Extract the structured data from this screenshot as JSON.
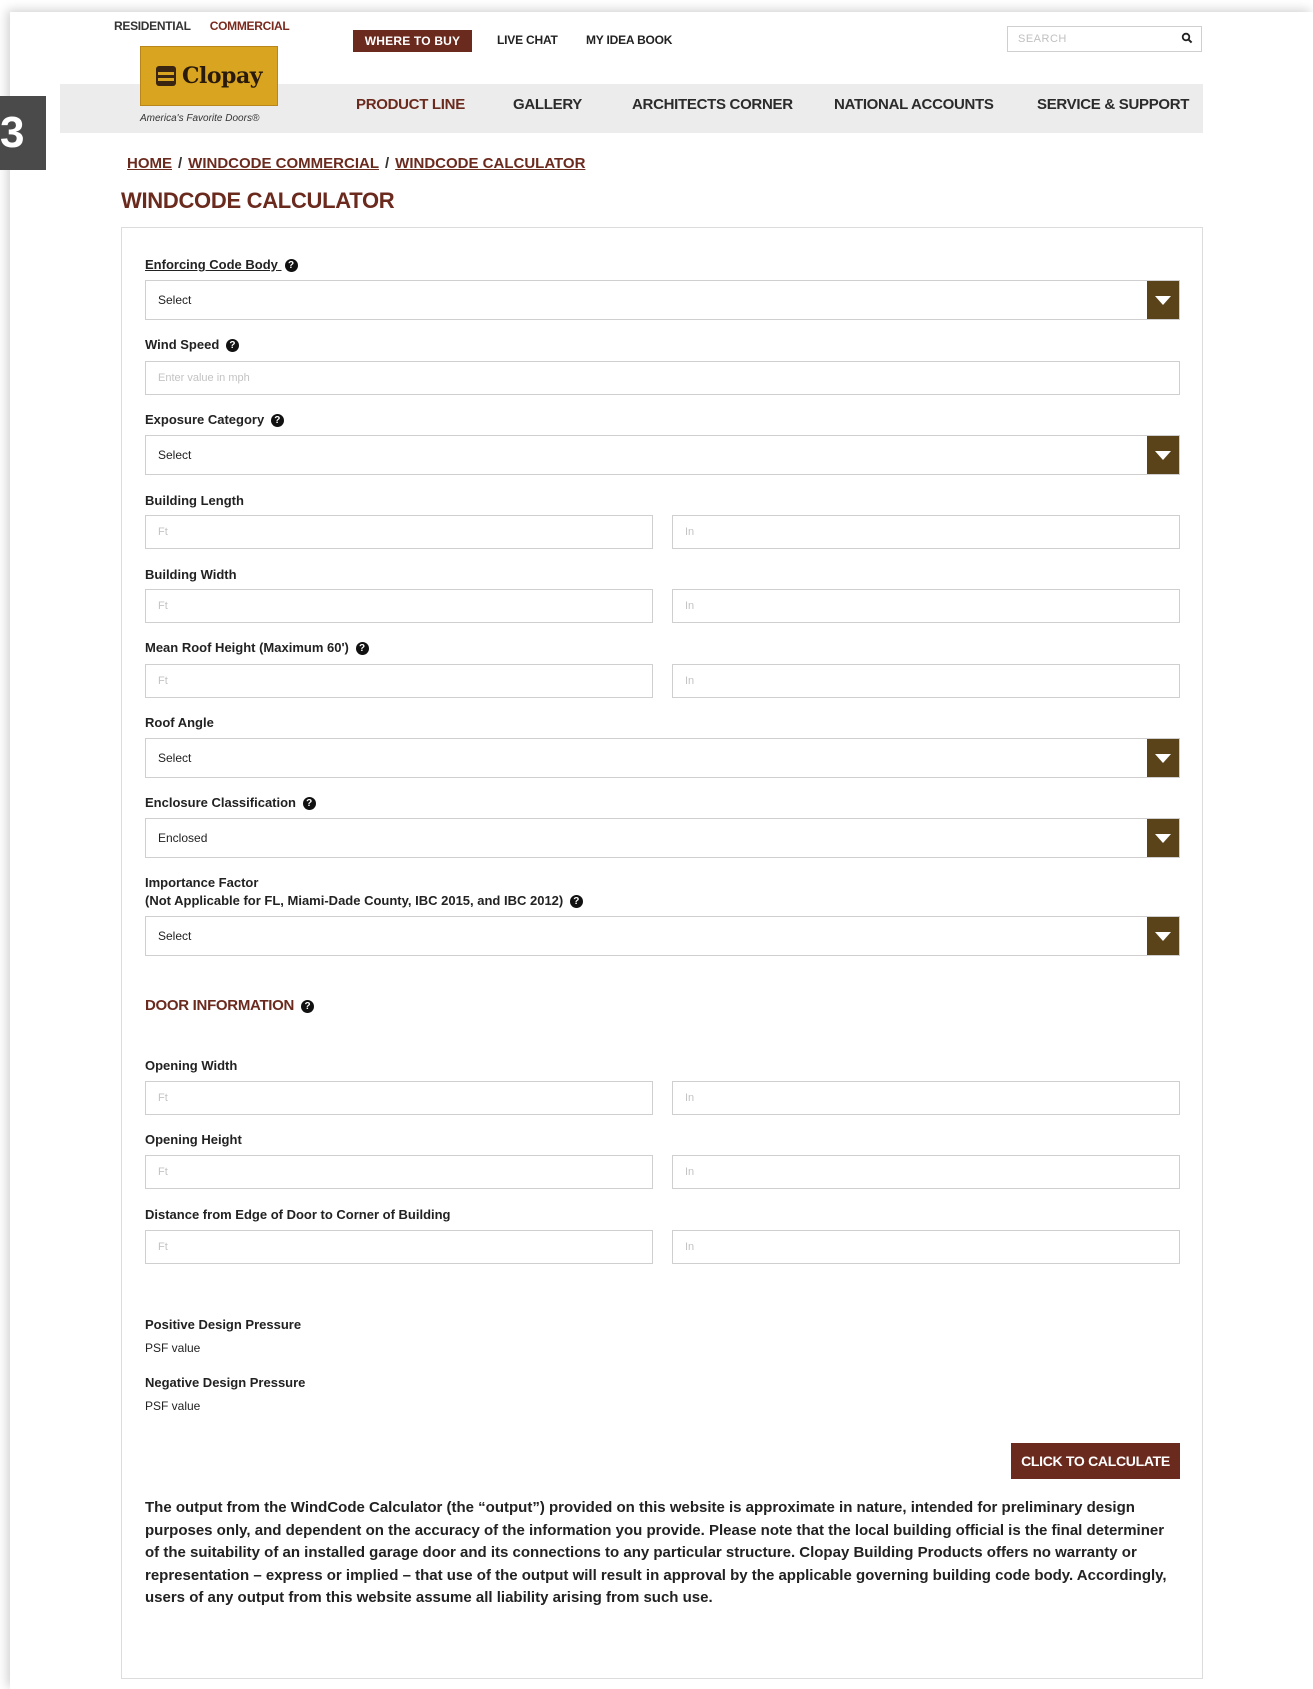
{
  "step_badge": "3",
  "header": {
    "site_tabs": {
      "residential": "RESIDENTIAL",
      "commercial": "COMMERCIAL"
    },
    "logo_text": "Clopay",
    "tagline": "America's Favorite Doors®",
    "where_to_buy": "WHERE TO BUY",
    "live_chat": "LIVE CHAT",
    "idea_book": "MY IDEA BOOK",
    "search_placeholder": "SEARCH",
    "nav": [
      "PRODUCT LINE",
      "GALLERY",
      "ARCHITECTS CORNER",
      "NATIONAL ACCOUNTS",
      "SERVICE & SUPPORT"
    ]
  },
  "breadcrumb": [
    "HOME",
    "WINDCODE COMMERCIAL",
    "WINDCODE CALCULATOR"
  ],
  "breadcrumb_sep": "/",
  "page_title": "WINDCODE CALCULATOR",
  "help_glyph": "?",
  "form": {
    "enforcing_code_body": {
      "label": "Enforcing Code Body",
      "value": "Select"
    },
    "wind_speed": {
      "label": "Wind Speed",
      "placeholder": "Enter value in mph"
    },
    "exposure_category": {
      "label": "Exposure Category",
      "value": "Select"
    },
    "building_length": {
      "label": "Building Length",
      "ft": "Ft",
      "in": "In"
    },
    "building_width": {
      "label": "Building Width",
      "ft": "Ft",
      "in": "In"
    },
    "mean_roof_height": {
      "label": "Mean Roof Height (Maximum 60')",
      "ft": "Ft",
      "in": "In"
    },
    "roof_angle": {
      "label": "Roof Angle",
      "value": "Select"
    },
    "enclosure_classification": {
      "label": "Enclosure Classification",
      "value": "Enclosed"
    },
    "importance_factor": {
      "label_line1": "Importance Factor",
      "label_line2": "(Not Applicable for FL, Miami-Dade County, IBC 2015, and IBC 2012)",
      "value": "Select"
    }
  },
  "door": {
    "section_title": "DOOR INFORMATION",
    "opening_width": {
      "label": "Opening Width",
      "ft": "Ft",
      "in": "In"
    },
    "opening_height": {
      "label": "Opening Height",
      "ft": "Ft",
      "in": "In"
    },
    "distance_edge": {
      "label": "Distance from Edge of Door to Corner of Building",
      "ft": "Ft",
      "in": "In"
    }
  },
  "results": {
    "positive_label": "Positive Design Pressure",
    "positive_value": "PSF value",
    "negative_label": "Negative Design Pressure",
    "negative_value": "PSF value"
  },
  "calculate_button": "CLICK TO CALCULATE",
  "disclaimer": "The output from the WindCode Calculator (the “output”) provided on this website is approximate in nature, intended for preliminary design purposes only, and dependent on the accuracy of the information you provide. Please note that the local building official is the final determiner of the suitability of an installed garage door and its connections to any particular structure. Clopay Building Products offers no warranty or representation – express or implied – that use of the output will result in approval by the applicable governing building code body.  Accordingly, users of any output from this website assume all liability arising from such use.",
  "colors": {
    "brand": "#6b2a1e",
    "select_button": "#5a4318",
    "logo": "#d9a520"
  }
}
